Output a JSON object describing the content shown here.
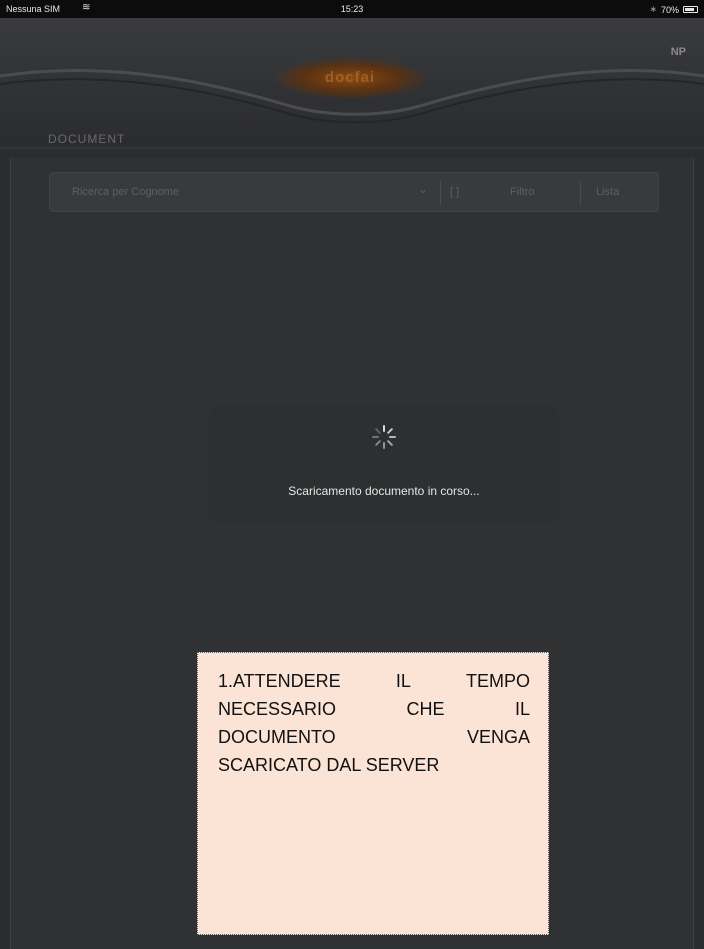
{
  "status_bar": {
    "carrier": "Nessuna SIM",
    "wifi_icon": "wifi-icon",
    "time": "15:23",
    "bluetooth_icon": "bluetooth-icon",
    "battery_text": "70%"
  },
  "header": {
    "logo_text": "docfai",
    "corner_button": "NP",
    "back_label": "DOCUMENT"
  },
  "toolbar": {
    "field_text": "Ricerca per Cognome",
    "button_1": "[ ]",
    "button_2": "Filtro",
    "button_3": "Lista"
  },
  "loading": {
    "spinner_icon": "spinner-icon",
    "message": "Scaricamento documento in corso..."
  },
  "note": {
    "lines": [
      [
        "1.ATTENDERE",
        "IL",
        "TEMPO"
      ],
      [
        "NECESSARIO",
        "CHE",
        "IL"
      ],
      [
        "DOCUMENTO",
        "VENGA"
      ],
      [
        "SCARICATO DAL SERVER"
      ]
    ],
    "background": "#fbe3d5"
  }
}
